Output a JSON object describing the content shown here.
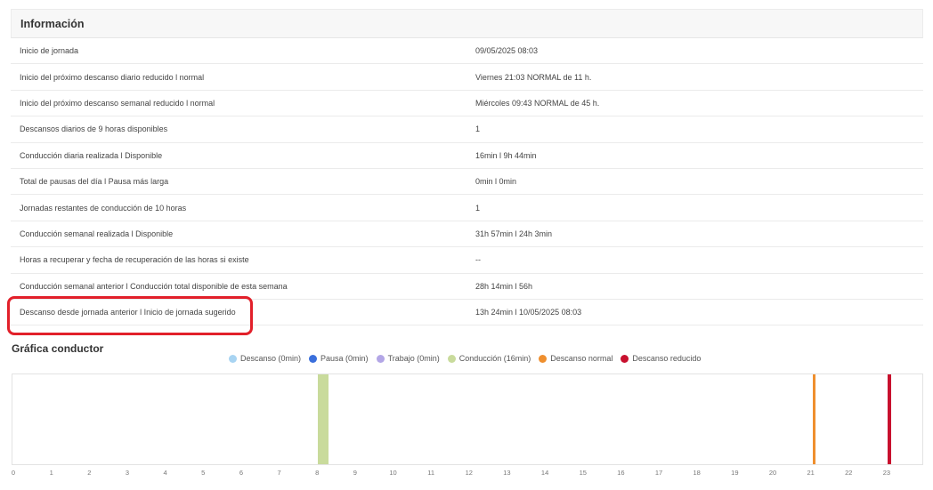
{
  "info": {
    "title": "Información",
    "rows": [
      {
        "label": "Inicio de jornada",
        "value": "09/05/2025 08:03"
      },
      {
        "label": "Inicio del próximo descanso diario reducido l normal",
        "value": "Viernes 21:03 NORMAL de 11 h."
      },
      {
        "label": "Inicio del próximo descanso semanal reducido l normal",
        "value": "Miércoles 09:43 NORMAL de 45 h."
      },
      {
        "label": "Descansos diarios de 9 horas disponibles",
        "value": "1"
      },
      {
        "label": "Conducción diaria realizada l Disponible",
        "value": "16min l 9h 44min"
      },
      {
        "label": "Total de pausas del día l Pausa más larga",
        "value": "0min l 0min"
      },
      {
        "label": "Jornadas restantes de conducción de 10 horas",
        "value": "1"
      },
      {
        "label": "Conducción semanal realizada l Disponible",
        "value": "31h 57min l 24h 3min"
      },
      {
        "label": "Horas a recuperar y fecha de recuperación de las horas si existe",
        "value": "--"
      },
      {
        "label": "Conducción semanal anterior l Conducción total disponible de esta semana",
        "value": "28h 14min l 56h"
      },
      {
        "label": "Descanso desde jornada anterior l Inicio de jornada sugerido",
        "value": "13h 24min l 10/05/2025 08:03"
      }
    ]
  },
  "chart_title": "Gráfica conductor",
  "chart_data": {
    "type": "bar",
    "x_ticks": [
      "0",
      "1",
      "2",
      "3",
      "4",
      "5",
      "6",
      "7",
      "8",
      "9",
      "10",
      "11",
      "12",
      "13",
      "14",
      "15",
      "16",
      "17",
      "18",
      "19",
      "20",
      "21",
      "22",
      "23"
    ],
    "xlim": [
      0,
      24
    ],
    "series": [
      {
        "name": "Descanso (0min)",
        "color": "#a8d4f2",
        "segments": []
      },
      {
        "name": "Pausa (0min)",
        "color": "#3a6fdc",
        "segments": []
      },
      {
        "name": "Trabajo (0min)",
        "color": "#b3a6e6",
        "segments": []
      },
      {
        "name": "Conducción (16min)",
        "color": "#c9db9c",
        "segments": [
          [
            8.0,
            8.27
          ]
        ]
      },
      {
        "name": "Descanso normal",
        "color": "#ef8f2e",
        "segments": [
          [
            21.03,
            21.1
          ]
        ]
      },
      {
        "name": "Descanso reducido",
        "color": "#c8102e",
        "segments": [
          [
            23.0,
            23.1
          ]
        ]
      }
    ]
  }
}
